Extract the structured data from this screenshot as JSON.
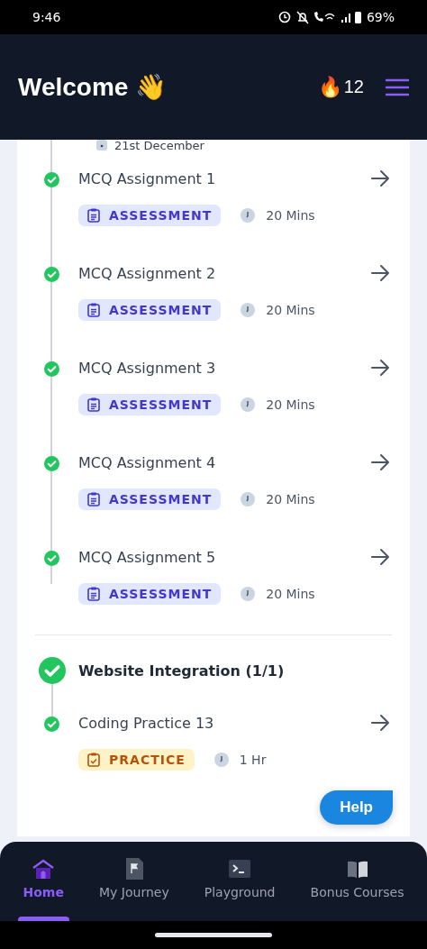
{
  "status_bar": {
    "time": "9:46",
    "battery": "69%"
  },
  "header": {
    "title": "Welcome 👋",
    "streak_icon": "🔥",
    "streak": "12"
  },
  "timeline": {
    "date": "21st December",
    "items": [
      {
        "title": "MCQ Assignment 1",
        "kind": "assessment",
        "tag": "ASSESSMENT",
        "duration": "20 Mins",
        "completed": true
      },
      {
        "title": "MCQ Assignment 2",
        "kind": "assessment",
        "tag": "ASSESSMENT",
        "duration": "20 Mins",
        "completed": true
      },
      {
        "title": "MCQ Assignment 3",
        "kind": "assessment",
        "tag": "ASSESSMENT",
        "duration": "20 Mins",
        "completed": true
      },
      {
        "title": "MCQ Assignment 4",
        "kind": "assessment",
        "tag": "ASSESSMENT",
        "duration": "20 Mins",
        "completed": true
      },
      {
        "title": "MCQ Assignment 5",
        "kind": "assessment",
        "tag": "ASSESSMENT",
        "duration": "20 Mins",
        "completed": true
      }
    ]
  },
  "section": {
    "title": "Website Integration (1/1)",
    "completed": true,
    "items": [
      {
        "title": "Coding Practice 13",
        "kind": "practice",
        "tag": "PRACTICE",
        "duration": "1 Hr",
        "completed": true
      }
    ]
  },
  "help_button": "Help",
  "bottom_nav": [
    {
      "label": "Home",
      "kind": "home",
      "selected": true
    },
    {
      "label": "My Journey",
      "kind": "flag",
      "selected": false
    },
    {
      "label": "Playground",
      "kind": "terminal",
      "selected": false
    },
    {
      "label": "Bonus Courses",
      "kind": "book",
      "selected": false
    }
  ]
}
